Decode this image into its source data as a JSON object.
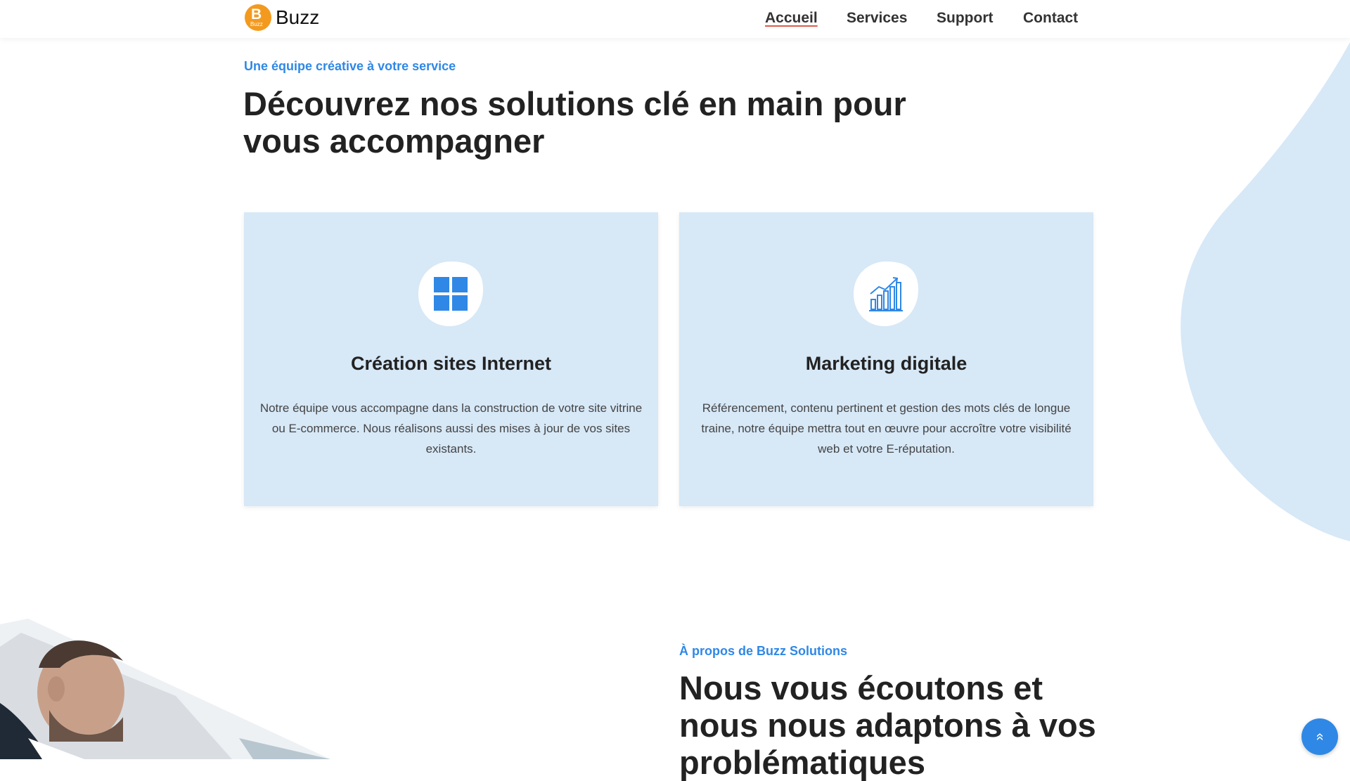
{
  "header": {
    "logo_mark": "B",
    "logo_sub": "Buzz",
    "logo_text": "Buzz",
    "nav": [
      {
        "label": "Accueil"
      },
      {
        "label": "Services"
      },
      {
        "label": "Support"
      },
      {
        "label": "Contact"
      }
    ]
  },
  "services": {
    "eyebrow": "Une équipe créative à votre service",
    "title_line1": "Découvrez nos solutions clé en main pour",
    "title_line2": "vous accompagner",
    "cards": [
      {
        "icon": "windows-grid-icon",
        "title": "Création sites Internet",
        "text": "Notre équipe vous accompagne dans la construction de votre site vitrine ou E-commerce. Nous réalisons aussi des mises à jour de vos sites existants."
      },
      {
        "icon": "bar-chart-growth-icon",
        "title": "Marketing digitale",
        "text": "Référencement, contenu pertinent et gestion des mots clés de longue traine, notre équipe mettra tout en œuvre pour accroître votre visibilité web et votre E-réputation."
      }
    ]
  },
  "about": {
    "eyebrow": "À propos de Buzz Solutions",
    "title_line1": "Nous vous écoutons et",
    "title_line2": "nous nous adaptons à vos",
    "title_line3": "problématiques"
  },
  "scroll_top": {
    "icon": "double-chevron-up-icon",
    "glyph": "»"
  },
  "colors": {
    "accent": "#2f88e6",
    "card_bg": "#d7e8f7",
    "logo": "#f39a1e",
    "underline": "#e05a4a"
  }
}
